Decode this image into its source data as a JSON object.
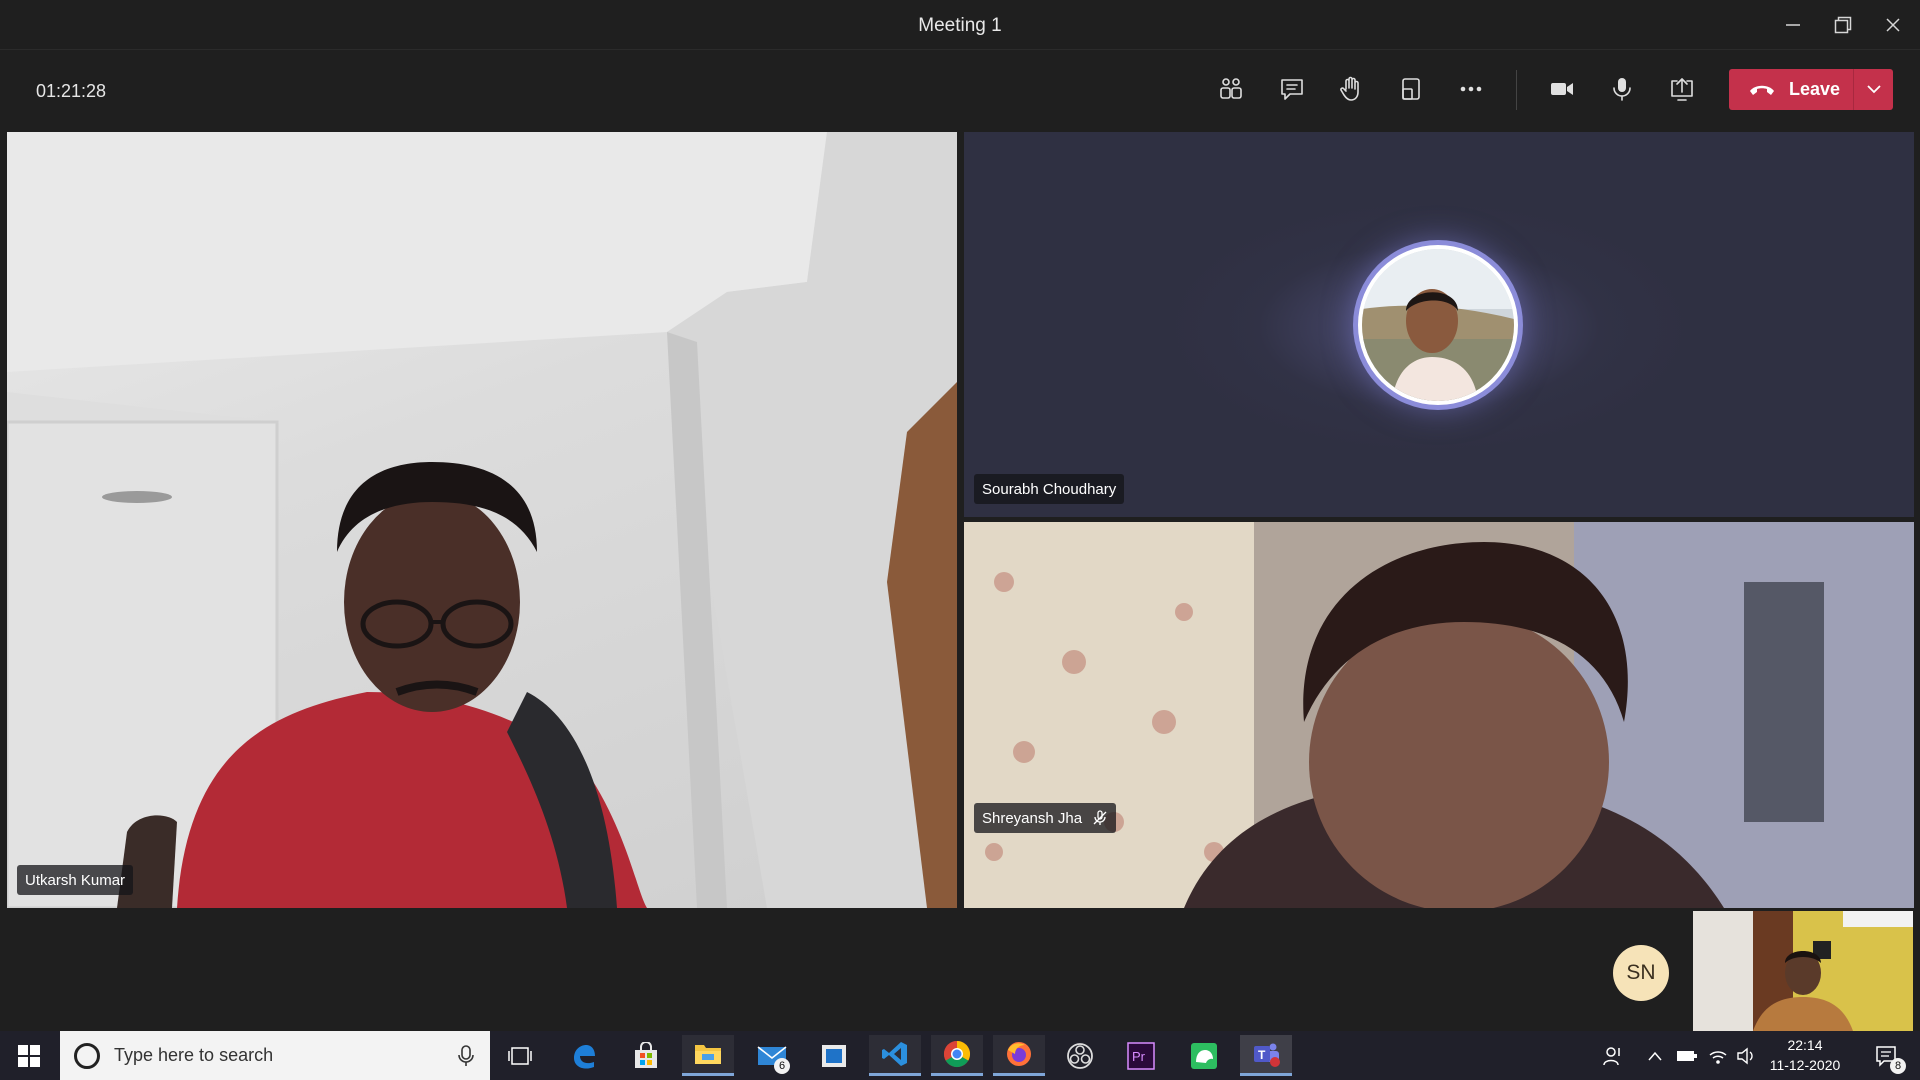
{
  "window": {
    "title": "Meeting 1"
  },
  "toolbar": {
    "timer": "01:21:28",
    "leave_label": "Leave",
    "buttons": [
      "people-icon",
      "chat-icon",
      "raise-hand-icon",
      "view-icon",
      "more-icon",
      "camera-icon",
      "mic-icon",
      "share-icon"
    ]
  },
  "participants": [
    {
      "name": "Utkarsh Kumar",
      "video": true
    },
    {
      "name": "Sourabh Choudhary",
      "video": false,
      "avatar": "photo"
    },
    {
      "name": "Shreyansh Jha",
      "video": true,
      "muted": true
    }
  ],
  "self": {
    "initials": "SN"
  },
  "taskbar": {
    "search_placeholder": "Type here to search",
    "mail_badge": "6",
    "time": "22:14",
    "date": "11-12-2020",
    "notifications": "8",
    "apps": [
      "task-view",
      "edge",
      "store",
      "file-explorer",
      "mail",
      "news",
      "vscode",
      "chrome",
      "firefox",
      "obs",
      "premiere",
      "evernote",
      "teams"
    ]
  },
  "colors": {
    "leave": "#c4314b",
    "avatar_ring": "#8b8cd9",
    "self_avatar_bg": "#f6e3b8",
    "tile_bg": "#2f3042"
  }
}
